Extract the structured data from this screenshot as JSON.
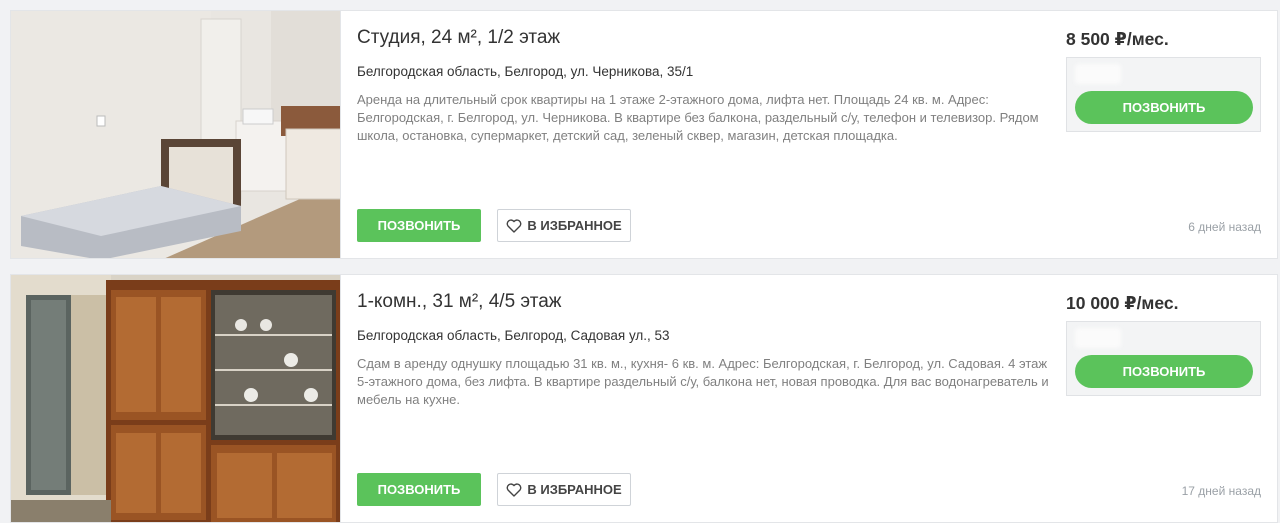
{
  "listings": [
    {
      "title": "Студия, 24 м², 1/2 этаж",
      "address": "Белгородская область, Белгород, ул. Черникова, 35/1",
      "description": "Аренда на длительный срок квартиры на 1 этаже 2-этажного дома, лифта нет. Площадь 24 кв. м. Адрес: Белгородская, г. Белгород, ул. Черникова. В квартире без балкона, раздельный с/у, телефон и телевизор. Рядом школа, остановка, супермаркет, детский сад, зеленый сквер, магазин, детская площадка.",
      "price": "8 500 ₽/мес.",
      "call_label": "ПОЗВОНИТЬ",
      "favorite_label": "В ИЗБРАННОЕ",
      "side_call_label": "ПОЗВОНИТЬ",
      "date": "6 дней назад"
    },
    {
      "title": "1-комн., 31 м², 4/5 этаж",
      "address": "Белгородская область, Белгород, Садовая ул., 53",
      "description": "Сдам в аренду однушку площадью 31 кв. м., кухня- 6 кв. м. Адрес: Белгородская, г. Белгород, ул. Садовая. 4 этаж 5-этажного дома, без лифта. В квартире раздельный с/у, балкона нет, новая проводка. Для вас водонагреватель и мебель на кухне.",
      "price": "10 000 ₽/мес.",
      "call_label": "ПОЗВОНИТЬ",
      "favorite_label": "В ИЗБРАННОЕ",
      "side_call_label": "ПОЗВОНИТЬ",
      "date": "17 дней назад"
    }
  ],
  "colors": {
    "accent_green": "#5bc35b",
    "muted_text": "#808080",
    "card_border": "#e3e5e8"
  },
  "icons": {
    "favorite": "heart-icon"
  }
}
